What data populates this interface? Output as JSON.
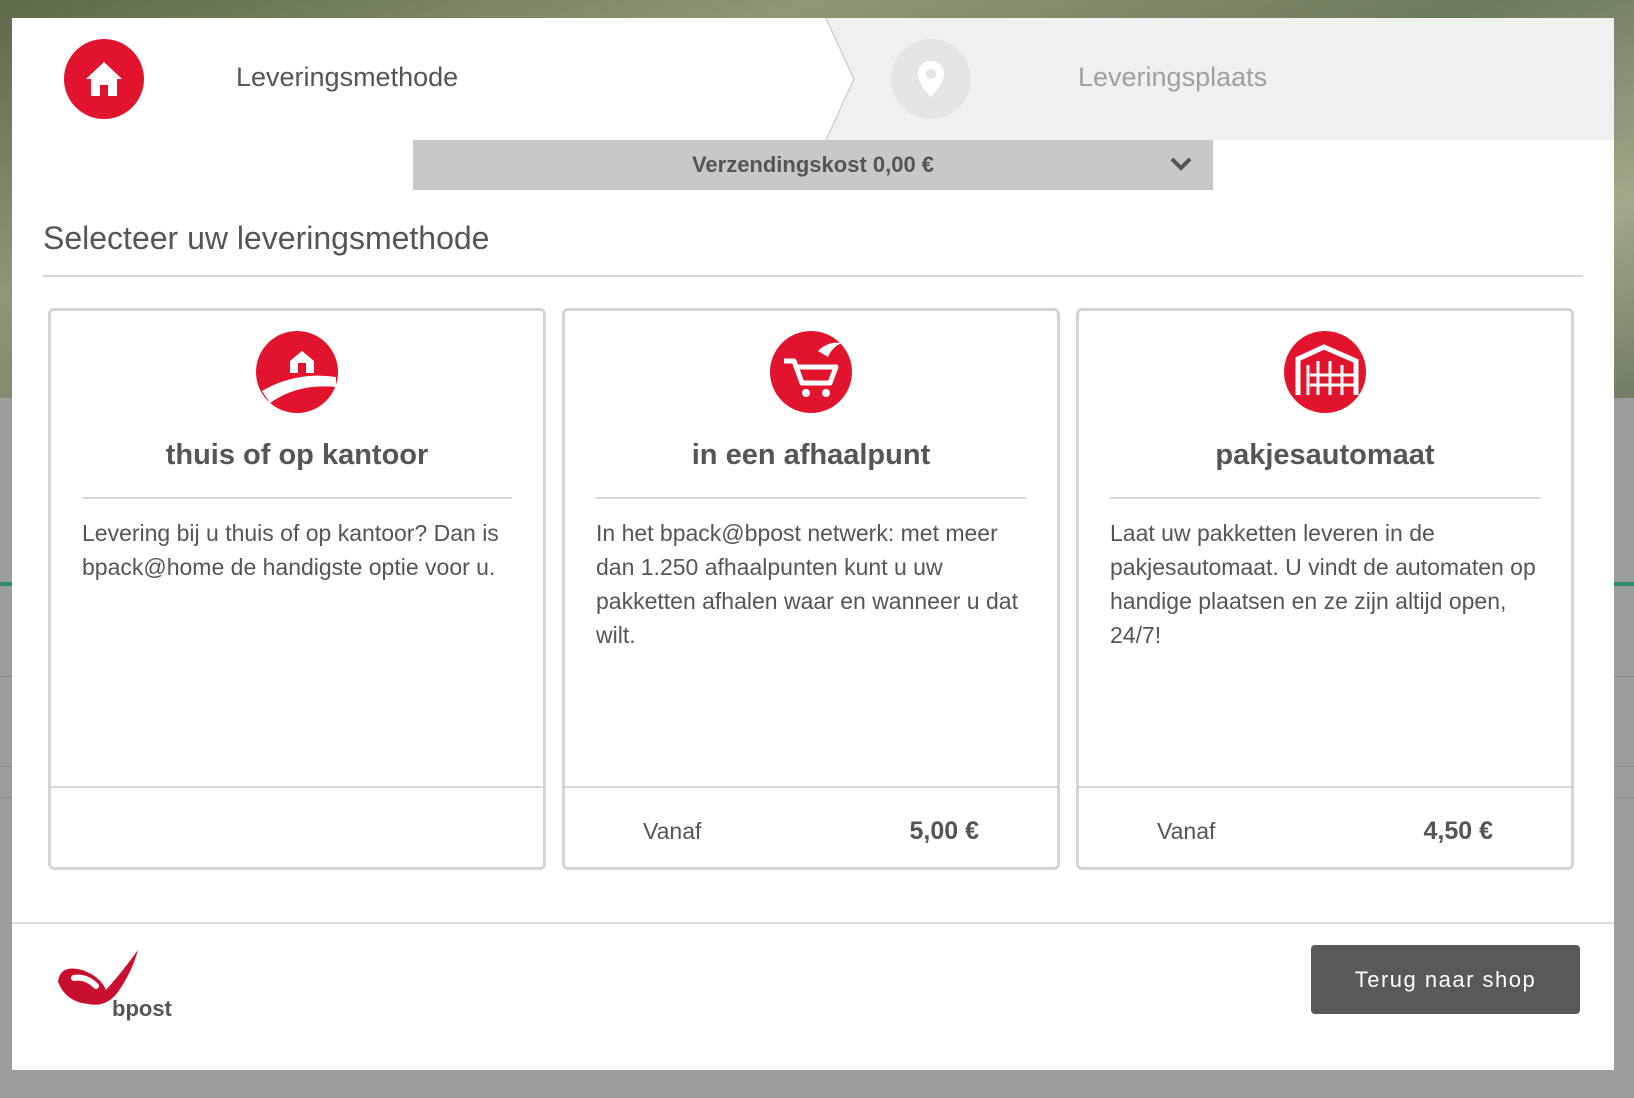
{
  "steps": {
    "step1_label": "Leveringsmethode",
    "step2_label": "Leveringsplaats",
    "step1_icon": "home-icon",
    "step2_icon": "location-pin-icon"
  },
  "shipping": {
    "label": "Verzendingskost 0,00 €"
  },
  "section": {
    "title": "Selecteer uw leveringsmethode"
  },
  "cards": [
    {
      "icon": "house-delivery-icon",
      "title": "thuis of op kantoor",
      "description": "Levering bij u thuis of op kantoor? Dan is bpack@home de handigste optie voor u.",
      "from_label": "",
      "price": ""
    },
    {
      "icon": "shopping-cart-icon",
      "title": "in een afhaalpunt",
      "description": "In het bpack@bpost netwerk: met meer dan 1.250 afhaalpunten kunt u uw pakketten afhalen waar en wanneer u dat wilt.",
      "from_label": "Vanaf",
      "price": "5,00 €"
    },
    {
      "icon": "parcel-locker-icon",
      "title": "pakjesautomaat",
      "description": "Laat uw pakketten leveren in de pakjesautomaat. U vindt de automaten op handige plaatsen en ze zijn altijd open, 24/7!",
      "from_label": "Vanaf",
      "price": "4,50 €"
    }
  ],
  "footer": {
    "logo_text": "bpost",
    "back_button": "Terug naar shop"
  },
  "colors": {
    "accent": "#e2132d",
    "button": "#58595b",
    "text": "#555555"
  }
}
